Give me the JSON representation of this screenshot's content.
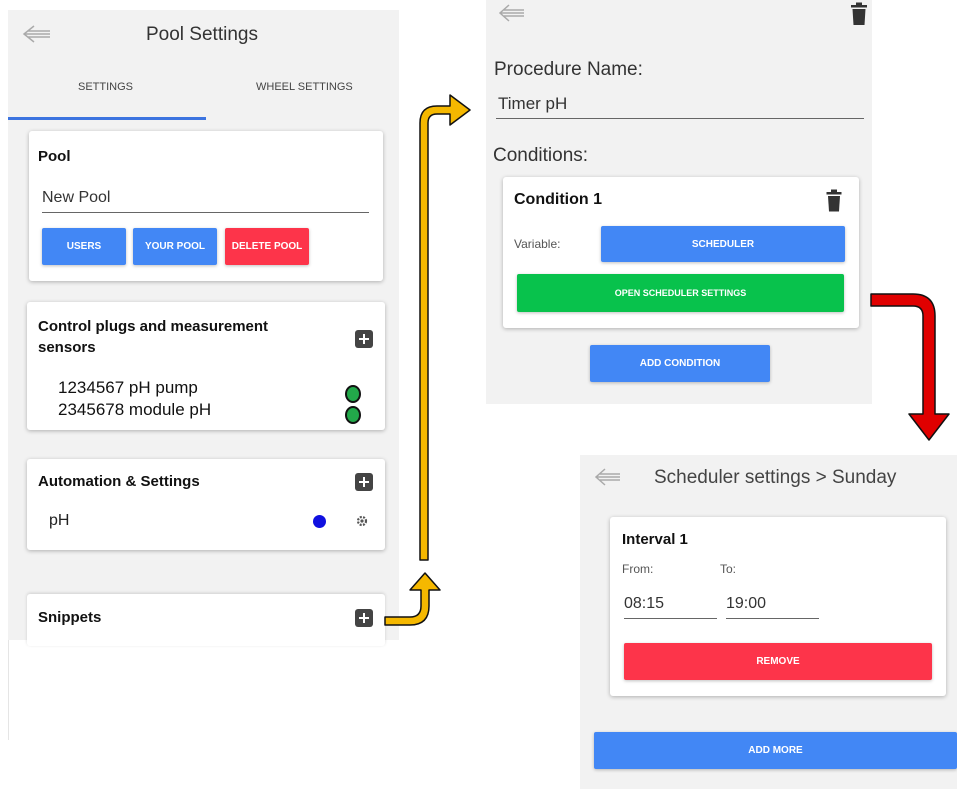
{
  "pool_screen": {
    "title": "Pool Settings",
    "tabs": [
      "SETTINGS",
      "WHEEL SETTINGS"
    ],
    "pool_card": {
      "heading": "Pool",
      "pool_name": "New Pool",
      "buttons": {
        "users": "USERS",
        "your_pool": "YOUR POOL",
        "delete_pool": "DELETE POOL"
      }
    },
    "plugs_card": {
      "heading_line1": "Control plugs and measurement",
      "heading_line2": "sensors",
      "items": [
        {
          "label": "1234567 pH pump",
          "status_color": "#22a84a"
        },
        {
          "label": "2345678 module pH",
          "status_color": "#22a84a"
        }
      ]
    },
    "automation_card": {
      "heading": "Automation & Settings",
      "item_label": "pH",
      "status_color": "#1010e0"
    },
    "snippets_card": {
      "heading": "Snippets"
    }
  },
  "procedure_screen": {
    "name_label": "Procedure Name:",
    "name_value": "Timer pH",
    "conditions_label": "Conditions:",
    "condition": {
      "title": "Condition 1",
      "variable_label": "Variable:",
      "variable_value": "SCHEDULER",
      "open_settings_button": "OPEN SCHEDULER SETTINGS"
    },
    "add_condition_button": "ADD CONDITION"
  },
  "scheduler_screen": {
    "title": "Scheduler settings > Sunday",
    "interval": {
      "title": "Interval 1",
      "from_label": "From:",
      "to_label": "To:",
      "from_value": "08:15",
      "to_value": "19:00",
      "remove_button": "REMOVE"
    },
    "add_more_button": "ADD MORE"
  },
  "colors": {
    "accent_blue": "#4287f5",
    "danger_red": "#fd344a",
    "success_green": "#08c24c",
    "flow_arrow_yellow": "#f5b800",
    "flow_arrow_red": "#e00000"
  }
}
